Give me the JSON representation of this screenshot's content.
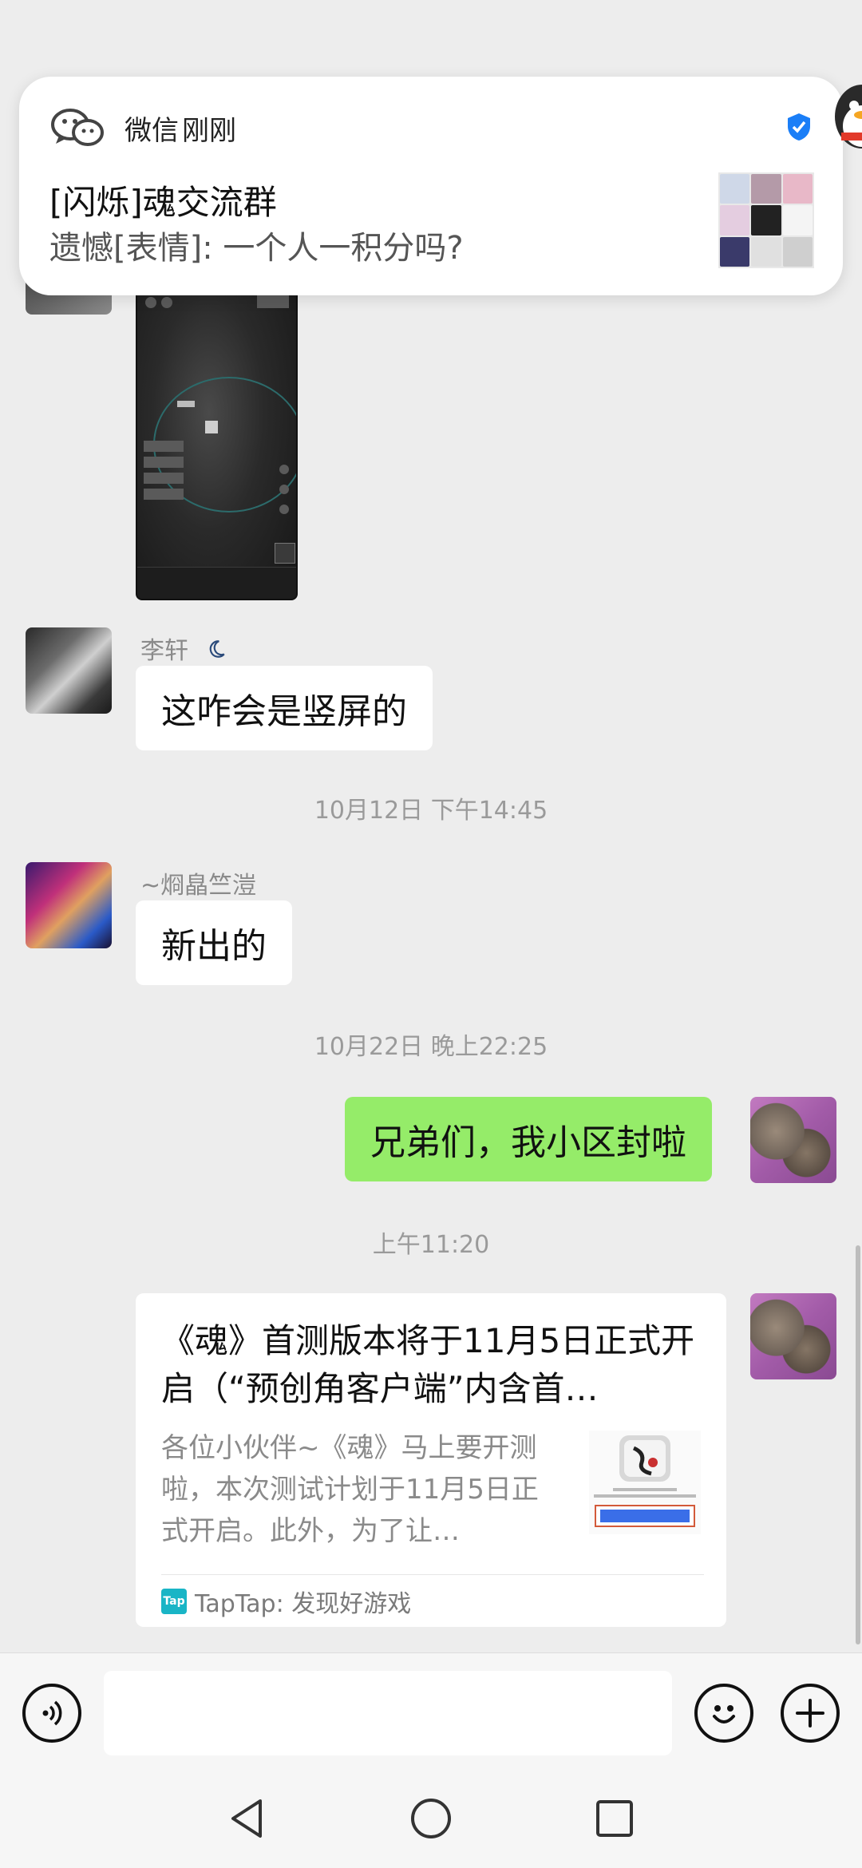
{
  "notification": {
    "app_name": "微信",
    "time": "刚刚",
    "title": "[闪烁]魂交流群",
    "message": "遗憾[表情]: 一个人一积分吗?"
  },
  "messages": [
    {
      "sender": "李轩",
      "text": "这咋会是竖屏的"
    },
    {
      "timestamp": "10月12日 下午14:45"
    },
    {
      "sender": "~烱皛竺溰",
      "text": "新出的"
    },
    {
      "timestamp": "10月22日 晚上22:25"
    },
    {
      "text": "兄弟们，我小区封啦",
      "outgoing": true
    },
    {
      "timestamp": "上午11:20"
    }
  ],
  "link_card": {
    "title": "《魂》首测版本将于11月5日正式开启（“预创角客户端”内含首…",
    "description": "各位小伙伴~《魂》马上要开测啦，本次测试计划于11月5日正式开启。此外，为了让…",
    "source": "TapTap: 发现好游戏",
    "source_icon": "Tap"
  },
  "colors": {
    "outgoing_bubble": "#95ec69",
    "chat_background": "#ededed",
    "verified_badge": "#1a7ef7"
  }
}
